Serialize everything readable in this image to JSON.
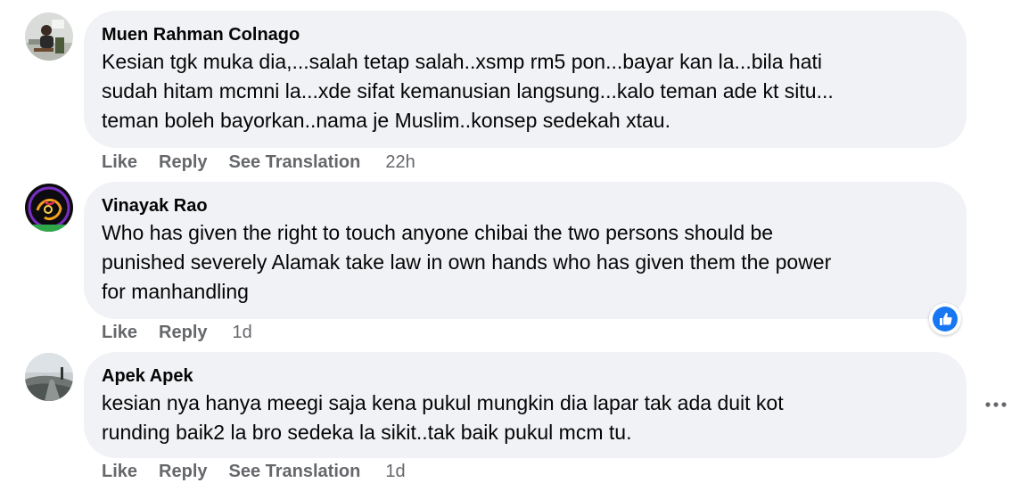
{
  "colors": {
    "bubble_bg": "#f0f2f5",
    "meta_text": "#65676b",
    "like_blue": "#1877f2"
  },
  "comments": [
    {
      "author": "Muen Rahman Colnago",
      "text": "Kesian tgk muka dia,...salah tetap salah..xsmp rm5 pon...bayar kan la...bila hati\nsudah hitam mcmni la...xde sifat kemanusian langsung...kalo teman ade kt situ...\nteman boleh bayorkan..nama je Muslim..konsep sedekah xtau.",
      "like_label": "Like",
      "reply_label": "Reply",
      "translate_label": "See Translation",
      "time": "22h",
      "avatar_icon": "person-at-desk-photo"
    },
    {
      "author": "Vinayak Rao",
      "text": "Who has given the right to touch anyone chibai the two persons should be\npunished severely Alamak take law in own hands who has given them the power\nfor manhandling",
      "like_label": "Like",
      "reply_label": "Reply",
      "time": "1d",
      "avatar_icon": "ganesha-neon-art",
      "reaction_icon": "like-reaction-icon"
    },
    {
      "author": "Apek Apek",
      "text": "kesian nya hanya meegi saja kena pukul mungkin dia lapar tak ada duit kot\nrunding baik2 la bro sedeka la sikit..tak baik pukul mcm tu.",
      "like_label": "Like",
      "reply_label": "Reply",
      "translate_label": "See Translation",
      "time": "1d",
      "avatar_icon": "road-landscape-photo"
    }
  ],
  "more_icon": "more-options-icon"
}
